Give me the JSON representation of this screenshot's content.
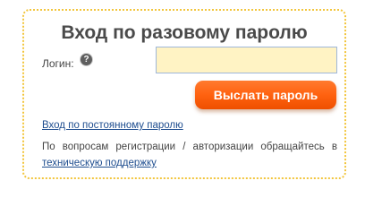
{
  "form": {
    "title": "Вход по разовому паролю",
    "login_label": "Логин:",
    "help_icon": "question-mark-icon",
    "help_glyph": "?",
    "login_value": "",
    "login_placeholder": "",
    "send_button_label": "Выслать пароль",
    "permanent_password_link": "Вход по постоянному паролю",
    "support_text": "По вопросам регистрации / авторизации обращайтесь в",
    "support_link": "техническую поддержку"
  },
  "colors": {
    "panel_border": "#f2c53c",
    "title_text": "#4a4a4a",
    "input_background": "#fff3c4",
    "input_border": "#9fb7d9",
    "button_orange": "#ff6210",
    "link_blue": "#1e4d8f"
  }
}
